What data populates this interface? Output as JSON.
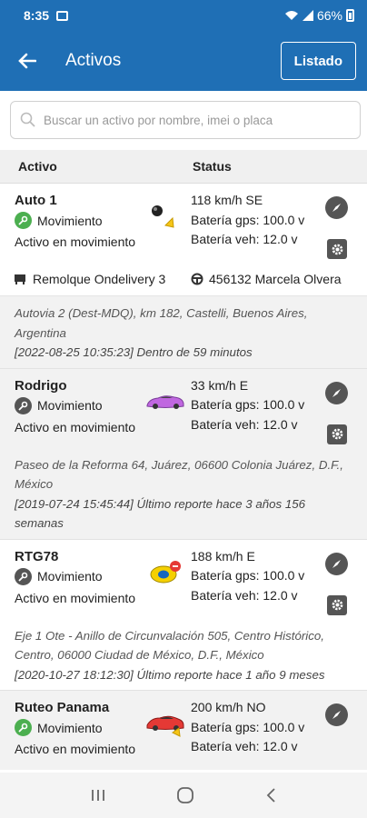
{
  "status_bar": {
    "time": "8:35",
    "battery": "66%"
  },
  "app_bar": {
    "title": "Activos",
    "listado_label": "Listado"
  },
  "search": {
    "placeholder": "Buscar un activo por nombre, imei o placa"
  },
  "table": {
    "col_activo": "Activo",
    "col_status": "Status"
  },
  "assets": [
    {
      "name": "Auto 1",
      "state": "Movimiento",
      "desc": "Activo en movimiento",
      "speed": "118 km/h SE",
      "gps": "Batería gps: 100.0 v",
      "veh": "Batería veh: 12.0 v",
      "meta_trailer": "Remolque Ondelivery 3",
      "meta_driver": "456132 Marcela Olvera",
      "address": "Autovia 2 (Dest-MDQ), km 182, Castelli, Buenos Aires, Argentina",
      "when": "[2022-08-25 10:35:23] Dentro de 59 minutos"
    },
    {
      "name": "Rodrigo",
      "state": "Movimiento",
      "desc": "Activo en movimiento",
      "speed": "33 km/h E",
      "gps": "Batería gps: 100.0 v",
      "veh": "Batería veh: 12.0 v",
      "address": "Paseo de la Reforma 64, Juárez, 06600 Colonia Juárez, D.F., México",
      "when": "[2019-07-24 15:45:44] Último reporte hace 3 años 156 semanas"
    },
    {
      "name": "RTG78",
      "state": "Movimiento",
      "desc": "Activo en movimiento",
      "speed": "188 km/h E",
      "gps": "Batería gps: 100.0 v",
      "veh": "Batería veh: 12.0 v",
      "address": "Eje 1 Ote - Anillo de Circunvalación 505, Centro Histórico, Centro, 06000 Ciudad de México, D.F., México",
      "when": "[2020-10-27 18:12:30] Último reporte hace 1 año 9 meses"
    },
    {
      "name": "Ruteo Panama",
      "state": "Movimiento",
      "desc": "Activo en movimiento",
      "speed": "200 km/h NO",
      "gps": "Batería gps: 100.0 v",
      "veh": "Batería veh: 12.0 v"
    }
  ]
}
